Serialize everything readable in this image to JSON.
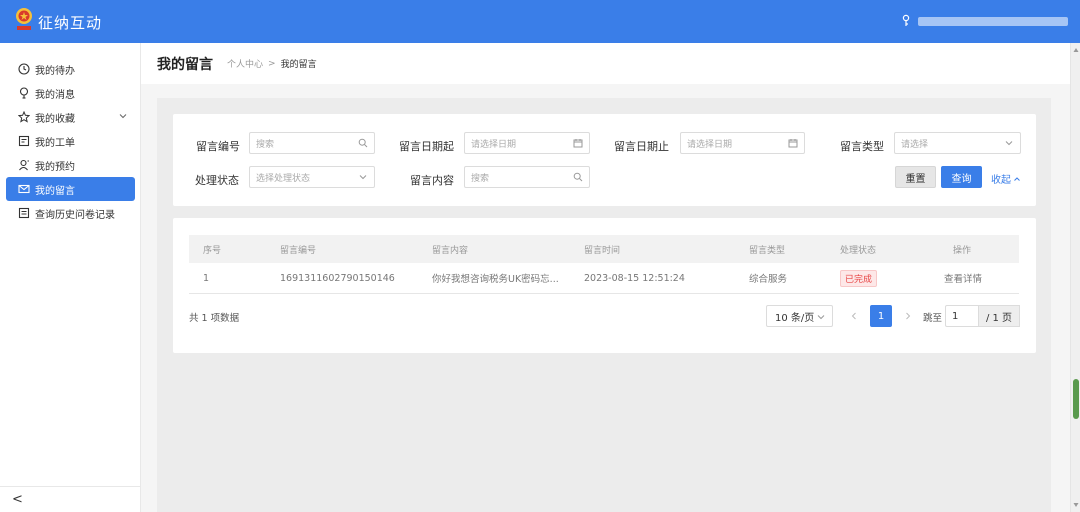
{
  "app": {
    "title": "征纳互动"
  },
  "sidebar": {
    "items": [
      {
        "label": "我的待办",
        "icon": "clock-icon",
        "active": false
      },
      {
        "label": "我的消息",
        "icon": "bulb-icon",
        "active": false
      },
      {
        "label": "我的收藏",
        "icon": "star-icon",
        "active": false,
        "expandable": true
      },
      {
        "label": "我的工单",
        "icon": "ticket-icon",
        "active": false
      },
      {
        "label": "我的预约",
        "icon": "person-icon",
        "active": false
      },
      {
        "label": "我的留言",
        "icon": "mail-icon",
        "active": true
      },
      {
        "label": "查询历史问卷记录",
        "icon": "survey-icon",
        "active": false
      }
    ],
    "collapse_label": "<"
  },
  "header": {
    "title": "我的留言",
    "breadcrumb": {
      "parent": "个人中心",
      "separator": ">",
      "current": "我的留言"
    }
  },
  "filters": {
    "msg_no": {
      "label": "留言编号",
      "placeholder": "搜索"
    },
    "date_from": {
      "label": "留言日期起",
      "placeholder": "请选择日期"
    },
    "date_to": {
      "label": "留言日期止",
      "placeholder": "请选择日期"
    },
    "msg_type": {
      "label": "留言类型",
      "placeholder": "请选择"
    },
    "status": {
      "label": "处理状态",
      "placeholder": "选择处理状态"
    },
    "content": {
      "label": "留言内容",
      "placeholder": "搜索"
    },
    "reset_label": "重置",
    "query_label": "查询",
    "collapse_label": "收起"
  },
  "table": {
    "columns": [
      "序号",
      "留言编号",
      "留言内容",
      "留言时间",
      "留言类型",
      "处理状态",
      "操作"
    ],
    "rows": [
      {
        "index": "1",
        "msg_no": "1691311602790150146",
        "content": "你好我想咨询税务UK密码忘...",
        "time": "2023-08-15 12:51:24",
        "type": "综合服务",
        "status": "已完成",
        "action": "查看详情"
      }
    ]
  },
  "pagination": {
    "total_text": "共 1 项数据",
    "page_size": "10 条/页",
    "current_page": "1",
    "jump_label": "跳至",
    "jump_value": "1",
    "total_pages": "/ 1 页"
  },
  "colors": {
    "primary": "#3a7ee8",
    "status_done": "#e84545"
  }
}
